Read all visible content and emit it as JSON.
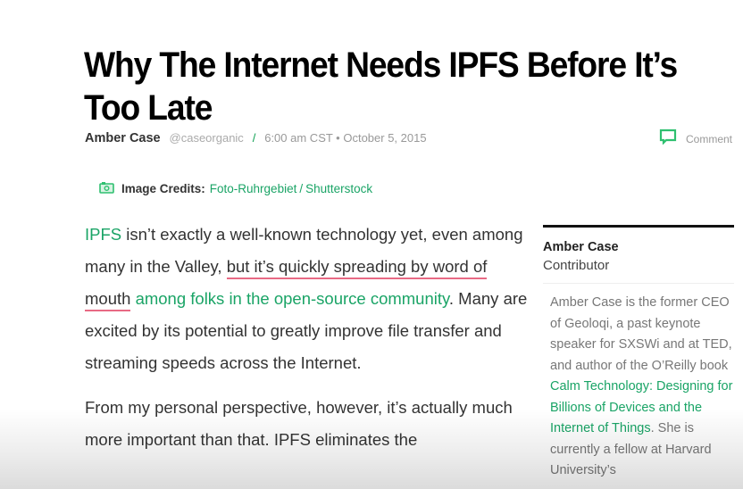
{
  "article": {
    "title": "Why The Internet Needs IPFS Before It’s Too Late",
    "byline": {
      "author": "Amber Case",
      "handle": "@caseorganic",
      "separator": "/",
      "time": "6:00 am CST • October 5, 2015"
    },
    "comment_label": "Comment",
    "image_credits": {
      "label": "Image Credits:",
      "source1": "Foto-Ruhrgebiet",
      "separator": "/",
      "source2": "Shutterstock"
    },
    "paragraphs": [
      {
        "link_ipfs": "IPFS",
        "text1": " isn’t exactly a well-known technology yet, even among many in the Valley, ",
        "highlighted": "but it’s quickly spreading by word of mouth",
        "space": " ",
        "link_folks": "among folks in the open-source community",
        "text2": ". Many are excited by its potential to greatly improve file transfer and streaming speeds across the Internet."
      },
      {
        "text": "From my personal perspective, however, it’s actually much more important than that. IPFS eliminates the"
      }
    ]
  },
  "sidebar": {
    "author_name": "Amber Case",
    "author_role": "Contributor",
    "bio_text1": "Amber Case is the former CEO of Geoloqi, a past keynote speaker for SXSWi and at TED, and author of the O’Reilly book ",
    "bio_link": "Calm Technology: Designing for Billions of Devices and the Internet of Things",
    "bio_text2": ". She is currently a fellow at Harvard University’s"
  },
  "colors": {
    "accent_green": "#1aa466",
    "highlight_pink": "#e86a84",
    "title": "#000000"
  }
}
